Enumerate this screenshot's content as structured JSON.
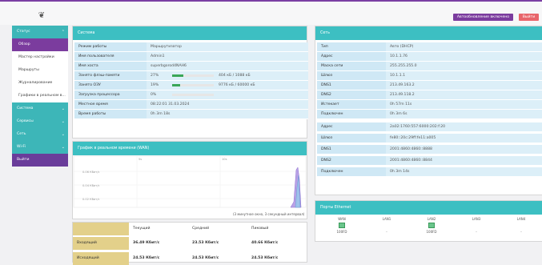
{
  "header": {
    "logo_icon": "router-logo-icon",
    "auto_button": "Автообновление включено",
    "logout_button": "Выйти"
  },
  "sidebar": {
    "status_label": "Статус",
    "status_chev": "⌃",
    "sub_items": [
      "Обзор",
      "Мастер настройки",
      "Маршруты",
      "Журналирование",
      "Графики в реальном в..."
    ],
    "groups": [
      {
        "label": "Система",
        "chev": "⌄"
      },
      {
        "label": "Сервисы",
        "chev": "⌄"
      },
      {
        "label": "Сеть",
        "chev": "⌄"
      },
      {
        "label": "Wi-Fi",
        "chev": "⌄"
      },
      {
        "label": "Выйти",
        "chev": ""
      }
    ]
  },
  "system": {
    "title": "Система",
    "rows": [
      {
        "label": "Режим работы",
        "value": "Маршрутизатор"
      },
      {
        "label": "Имя пользователя",
        "value": "Admin1"
      },
      {
        "label": "Имя хоста",
        "value": "superbgorod4NAH6"
      },
      {
        "label": "Занято флэш-памяти",
        "value": "27%",
        "extra": "404 кБ / 1088 кБ",
        "pct": 0.27
      },
      {
        "label": "Занято ОЗУ",
        "value": "19%",
        "extra": "9776 кБ / 60000 кБ",
        "pct": 0.19
      },
      {
        "label": "Загрузка процессора",
        "value": "0%",
        "pct": 0.0
      },
      {
        "label": "Местное время",
        "value": "08:22:01 31.03.2024"
      },
      {
        "label": "Время работы",
        "value": "0h 3m 18s"
      }
    ]
  },
  "chart": {
    "title": "График в реальном времени (WAN)",
    "y_ticks": [
      "0.06 Кбит/с",
      "0.04 Кбит/с",
      "0.02 Кбит/с"
    ],
    "x_marks": [
      "5s",
      "10s"
    ],
    "caption": "(3 минутное окно, 3 секундный интервал)"
  },
  "traffic": {
    "headers": [
      "",
      "Текущий",
      "Средний",
      "Пиковый"
    ],
    "rows": [
      {
        "label": "Входящий",
        "cur": "36.49 Кбит/с",
        "avg": "23.53 Кбит/с",
        "peak": "40.66 Кбит/с"
      },
      {
        "label": "Исходящий",
        "cur": "24.53 Кбит/с",
        "avg": "24.53 Кбит/с",
        "peak": "24.53 Кбит/с"
      }
    ]
  },
  "network": {
    "title": "Сеть",
    "rows": [
      {
        "label": "Тип",
        "value": "Авто (DHCP)"
      },
      {
        "label": "Адрес",
        "value": "10.1.1.76"
      },
      {
        "label": "Маска сети",
        "value": "255.255.255.0"
      },
      {
        "label": "Шлюз",
        "value": "10.1.1.1"
      },
      {
        "label": "DNS1",
        "value": "213.49.163.2"
      },
      {
        "label": "DNS2",
        "value": "213.49.118.2"
      },
      {
        "label": "Истекает",
        "value": "0h 57m 11s"
      },
      {
        "label": "Подключен",
        "value": "0h 3m 6s"
      }
    ],
    "v6_rows": [
      {
        "label": "Адрес",
        "value": "2a02:1760:557:6000:202:f:20"
      },
      {
        "label": "Шлюз",
        "value": "fe80::20c:29ff:fe11:a005"
      },
      {
        "label": "DNS1",
        "value": "2001:4860:4860::8888"
      },
      {
        "label": "DNS2",
        "value": "2001:4860:4860::8844"
      },
      {
        "label": "Подключен",
        "value": "0h 3m 14s"
      }
    ]
  },
  "ports": {
    "title": "Порты Ethernet",
    "items": [
      {
        "name": "WAN",
        "speed": "100FD",
        "connected": true
      },
      {
        "name": "LAN1",
        "speed": "-",
        "connected": false
      },
      {
        "name": "LAN2",
        "speed": "100FD",
        "connected": true
      },
      {
        "name": "LAN3",
        "speed": "-",
        "connected": false
      },
      {
        "name": "LAN4",
        "speed": "-",
        "connected": false
      }
    ]
  }
}
